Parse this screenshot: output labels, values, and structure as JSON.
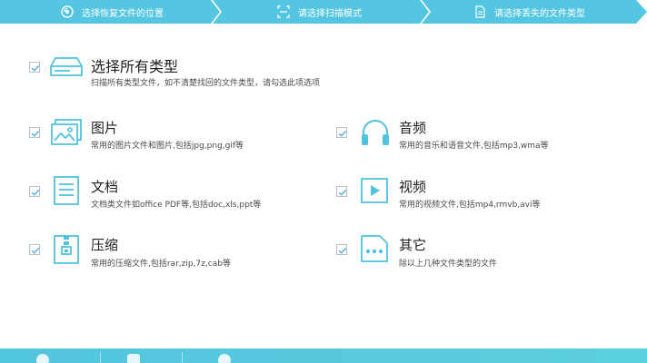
{
  "steps": [
    {
      "label": "选择恢复文件的位置",
      "icon": "disc-icon"
    },
    {
      "label": "请选择扫描模式",
      "icon": "scan-frame-icon"
    },
    {
      "label": "请选择丢失的文件类型",
      "icon": "document-icon"
    }
  ],
  "all_types": {
    "title": "选择所有类型",
    "desc": "扫描所有类型文件，如不清楚找回的文件类型，请勾选此项选项",
    "checked": true
  },
  "types": [
    {
      "key": "images",
      "title": "图片",
      "desc": "常用的图片文件和图片,包括jpg,png,gif等",
      "icon": "image-icon",
      "checked": true
    },
    {
      "key": "audio",
      "title": "音频",
      "desc": "常用的音乐和语音文件,包括mp3,wma等",
      "icon": "headphones-icon",
      "checked": true
    },
    {
      "key": "docs",
      "title": "文档",
      "desc": "文档类文件如office PDF等,包括doc,xls,ppt等",
      "icon": "document-icon",
      "checked": true
    },
    {
      "key": "video",
      "title": "视频",
      "desc": "常用的视频文件,包括mp4,rmvb,avi等",
      "icon": "play-icon",
      "checked": true
    },
    {
      "key": "archive",
      "title": "压缩",
      "desc": "常用的压缩文件,包括rar,zip,7z,cab等",
      "icon": "zip-icon",
      "checked": true
    },
    {
      "key": "other",
      "title": "其它",
      "desc": "除以上几种文件类型的文件",
      "icon": "more-icon",
      "checked": true
    }
  ],
  "colors": {
    "accent": "#4fc3e0",
    "step_bg": "#55c6e2",
    "check": "#5fb8d6"
  }
}
